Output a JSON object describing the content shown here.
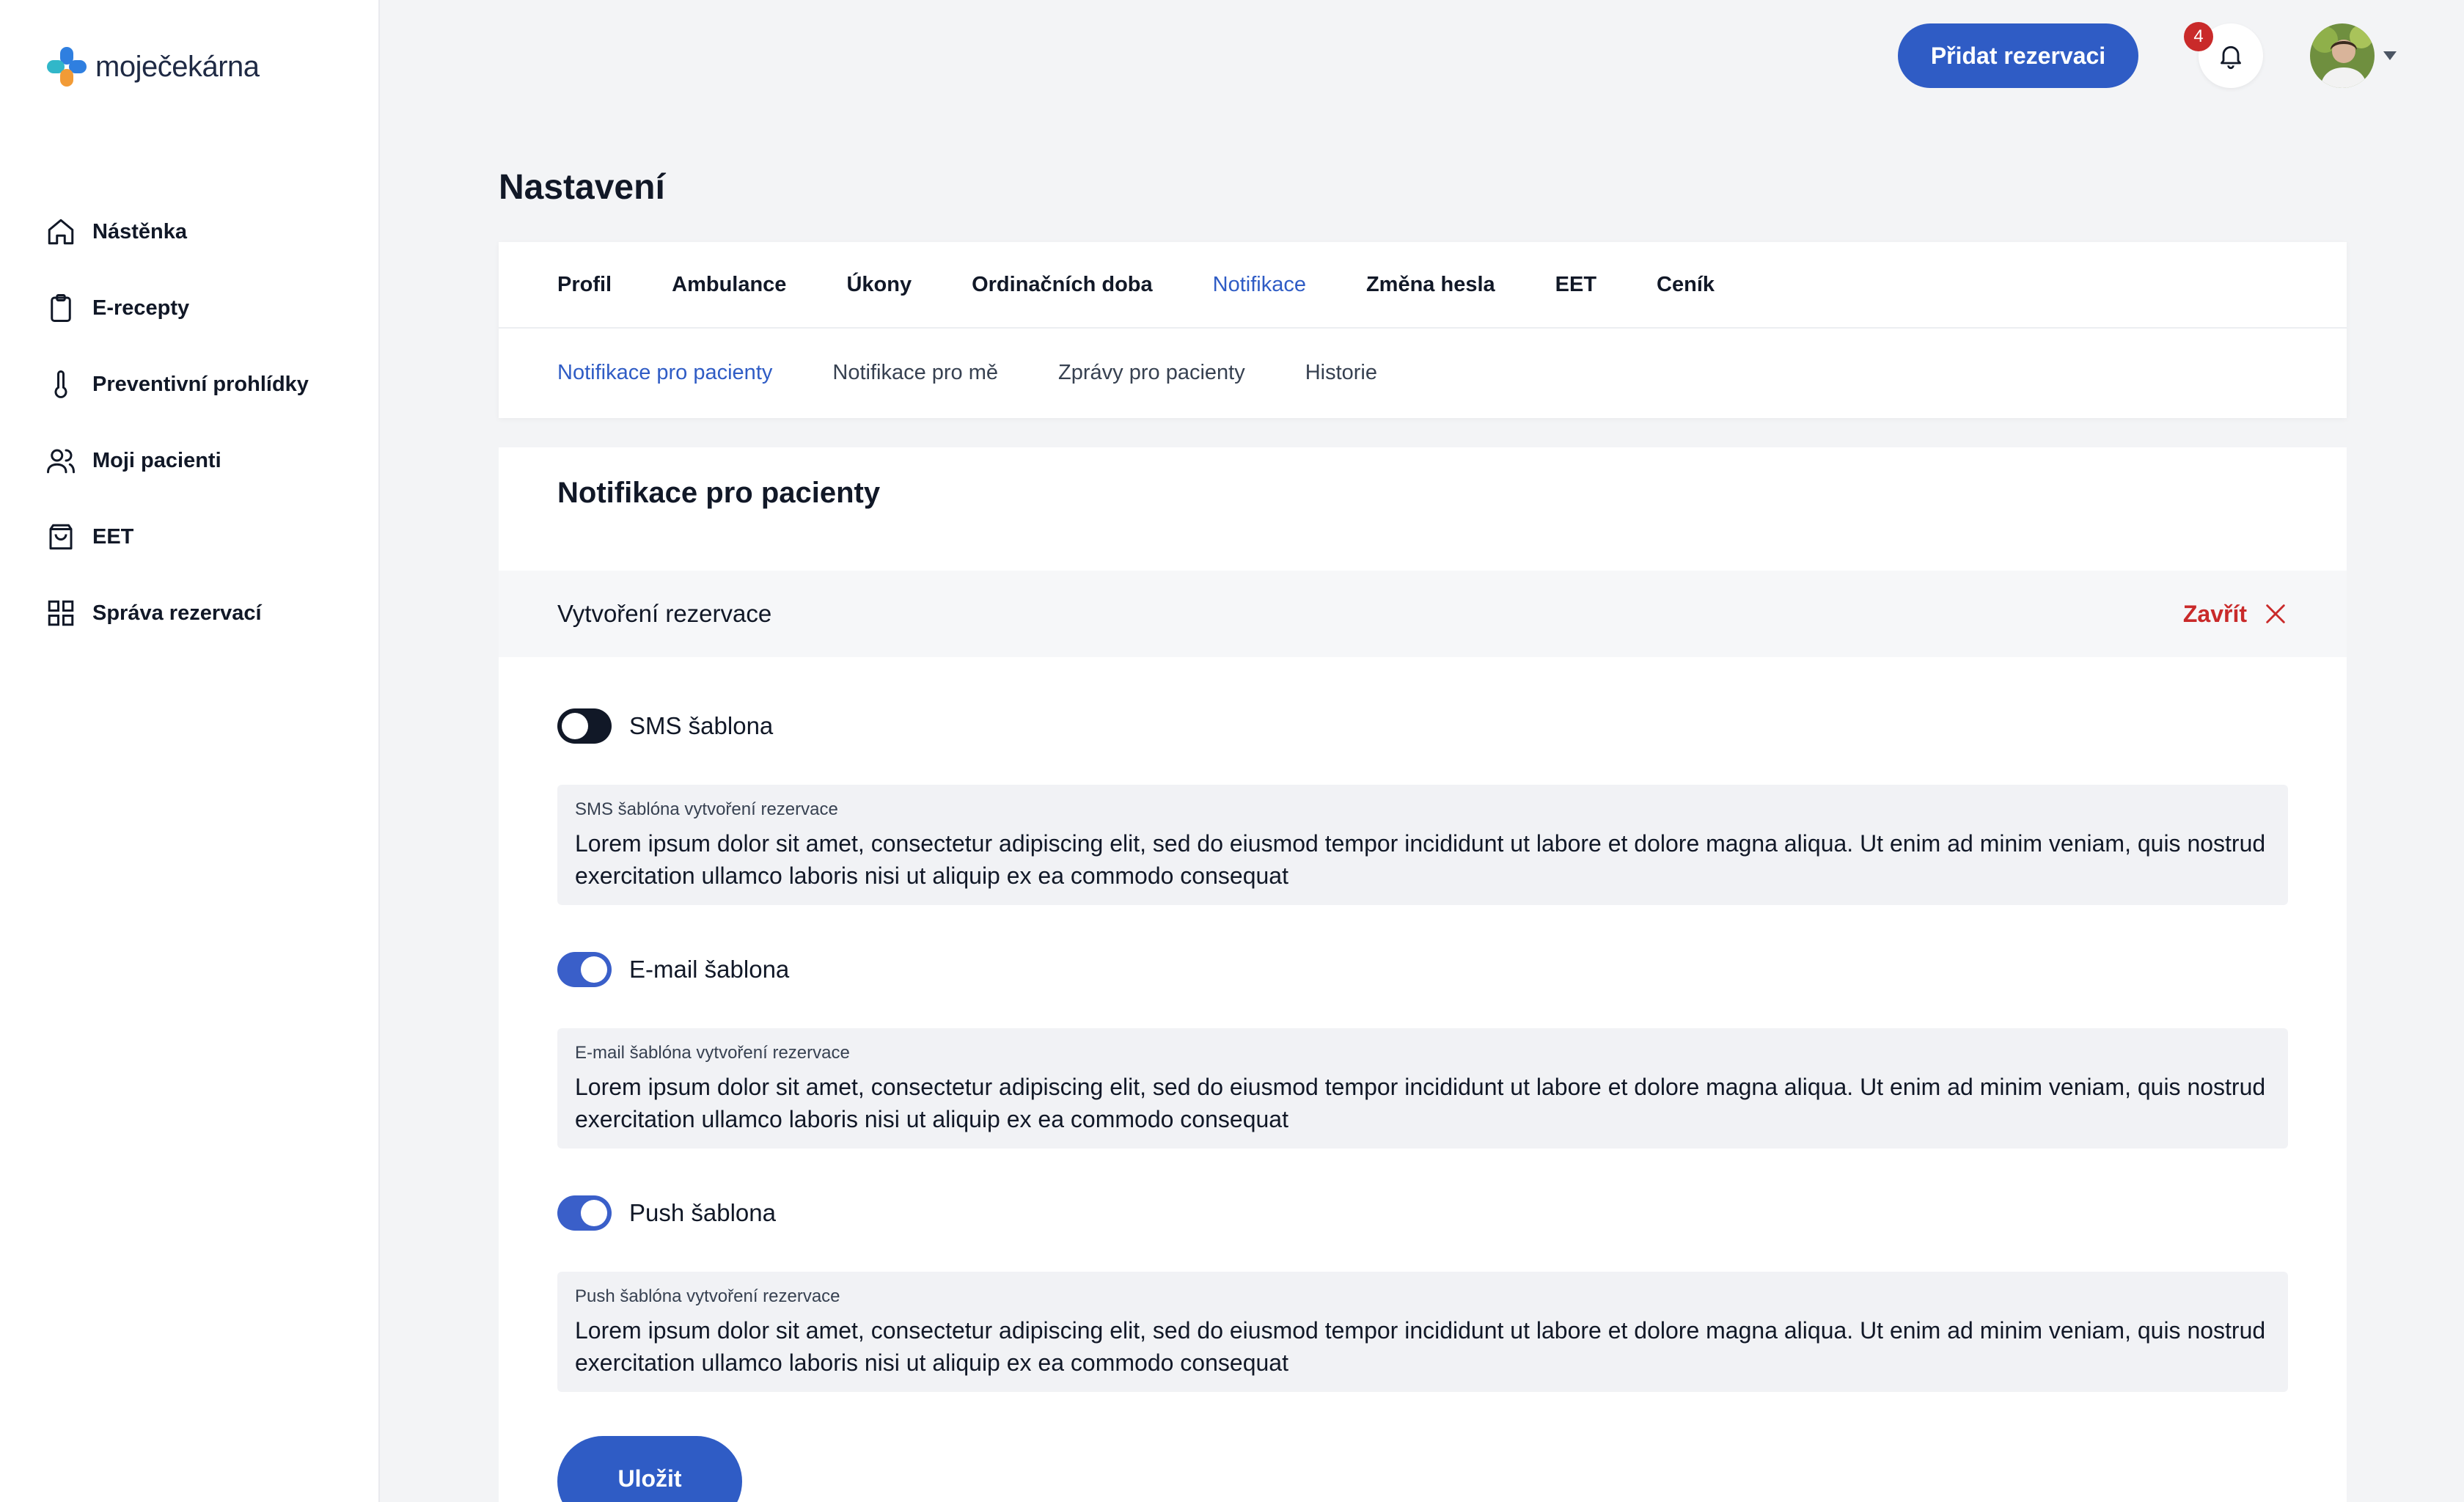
{
  "app": {
    "logo_text": "moječekárna"
  },
  "sidebar": {
    "items": [
      {
        "label": "Nástěnka",
        "icon": "home-icon"
      },
      {
        "label": "E-recepty",
        "icon": "clipboard-icon"
      },
      {
        "label": "Preventivní prohlídky",
        "icon": "thermometer-icon"
      },
      {
        "label": "Moji pacienti",
        "icon": "users-icon"
      },
      {
        "label": "EET",
        "icon": "shopping-bag-icon"
      },
      {
        "label": "Správa rezervací",
        "icon": "grid-icon"
      }
    ]
  },
  "header": {
    "add_reservation": "Přidat rezervaci",
    "notification_count": "4"
  },
  "page": {
    "title": "Nastavení"
  },
  "tabs": [
    {
      "label": "Profil",
      "active": false
    },
    {
      "label": "Ambulance",
      "active": false
    },
    {
      "label": "Úkony",
      "active": false
    },
    {
      "label": "Ordinačních doba",
      "active": false
    },
    {
      "label": "Notifikace",
      "active": true
    },
    {
      "label": "Změna hesla",
      "active": false
    },
    {
      "label": "EET",
      "active": false
    },
    {
      "label": "Ceník",
      "active": false
    }
  ],
  "subtabs": [
    {
      "label": "Notifikace pro pacienty",
      "active": true
    },
    {
      "label": "Notifikace pro mě",
      "active": false
    },
    {
      "label": "Zprávy pro pacienty",
      "active": false
    },
    {
      "label": "Historie",
      "active": false
    }
  ],
  "content": {
    "section_title": "Notifikace pro pacienty",
    "accordion_title": "Vytvoření rezervace",
    "close_label": "Zavřít",
    "templates": [
      {
        "toggle_label": "SMS šablona",
        "enabled": false,
        "field_label": "SMS šablóna vytvoření rezervace",
        "text": "Lorem ipsum dolor sit amet, consectetur adipiscing elit, sed do eiusmod tempor incididunt ut labore et dolore magna aliqua. Ut enim ad minim veniam, quis nostrud exercitation ullamco laboris nisi ut aliquip ex ea commodo consequat"
      },
      {
        "toggle_label": "E-mail šablona",
        "enabled": true,
        "field_label": "E-mail šablóna vytvoření rezervace",
        "text": "Lorem ipsum dolor sit amet, consectetur adipiscing elit, sed do eiusmod tempor incididunt ut labore et dolore magna aliqua. Ut enim ad minim veniam, quis nostrud exercitation ullamco laboris nisi ut aliquip ex ea commodo consequat"
      },
      {
        "toggle_label": "Push šablona",
        "enabled": true,
        "field_label": "Push šablóna vytvoření rezervace",
        "text": "Lorem ipsum dolor sit amet, consectetur adipiscing elit, sed do eiusmod tempor incididunt ut labore et dolore magna aliqua. Ut enim ad minim veniam, quis nostrud exercitation ullamco laboris nisi ut aliquip ex ea commodo consequat"
      }
    ],
    "save_label": "Uložit"
  },
  "colors": {
    "primary": "#2f5cc5",
    "danger": "#c92a2a",
    "text": "#111827",
    "background": "#f3f4f6"
  }
}
